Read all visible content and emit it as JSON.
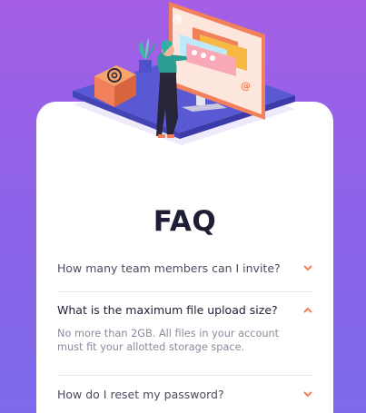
{
  "faq": {
    "title": "FAQ",
    "items": [
      {
        "question": "How many team members can I invite?",
        "expanded": false
      },
      {
        "question": "What is the maximum file upload size?",
        "expanded": true,
        "answer": "No more than 2GB. All files in your account must fit your allotted storage space."
      },
      {
        "question": "How do I reset my password?",
        "expanded": false
      }
    ]
  },
  "colors": {
    "background_top": "#a45fe6",
    "background_bottom": "#7d6aea",
    "title": "#1e1f36",
    "chevron": "#f47b56",
    "answer_text": "#8a8b9b"
  }
}
